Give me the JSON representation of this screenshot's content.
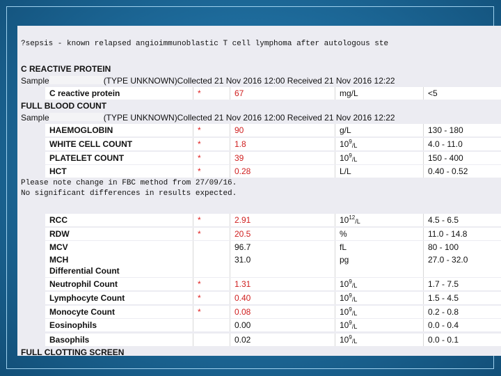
{
  "report": {
    "clinical_note": "?sepsis - known relapsed angioimmunoblastic T cell lymphoma after autologous ste",
    "crp": {
      "heading": "C REACTIVE PROTEIN",
      "sample_prefix": "Sample",
      "sample_suffix": "(TYPE UNKNOWN)Collected 21 Nov 2016 12:00 Received 21 Nov 2016 12:22",
      "rows": [
        {
          "name": "C reactive protein",
          "flag": "*",
          "value": "67",
          "unit": "mg/L",
          "ref": "<5"
        }
      ]
    },
    "fbc": {
      "heading": "FULL BLOOD COUNT",
      "sample_prefix": "Sample",
      "sample_suffix": "(TYPE UNKNOWN)Collected 21 Nov 2016 12:00 Received 21 Nov 2016 12:22",
      "rows_a": [
        {
          "name": "HAEMOGLOBIN",
          "flag": "*",
          "value": "90",
          "unit": "g/L",
          "ref": "130 - 180"
        },
        {
          "name": "WHITE CELL COUNT",
          "flag": "*",
          "value": "1.8",
          "unit_base": "10",
          "unit_exp": "9",
          "unit_tail": "/L",
          "ref": "4.0 - 11.0"
        },
        {
          "name": "PLATELET COUNT",
          "flag": "*",
          "value": "39",
          "unit_base": "10",
          "unit_exp": "9",
          "unit_tail": "/L",
          "ref": "150 - 400"
        },
        {
          "name": "HCT",
          "flag": "*",
          "value": "0.28",
          "unit": "L/L",
          "ref": "0.40 - 0.52"
        }
      ],
      "note_line1": "Please note change in FBC method from 27/09/16.",
      "note_line2": "No significant differences in results expected.",
      "rows_b": [
        {
          "name": "RCC",
          "flag": "*",
          "value": "2.91",
          "unit_base": "10",
          "unit_exp": "12",
          "unit_tail": "/L",
          "ref": "4.5 - 6.5"
        },
        {
          "name": "RDW",
          "flag": "*",
          "value": "20.5",
          "unit": "%",
          "ref": "11.0 - 14.8"
        },
        {
          "name": "MCV",
          "flag": "",
          "value": "96.7",
          "unit": "fL",
          "ref": "80 - 100"
        },
        {
          "name": "MCH",
          "flag": "",
          "value": "31.0",
          "unit": "pg",
          "ref": "27.0 - 32.0"
        },
        {
          "name": "Differential Count",
          "flag": "",
          "value": "",
          "unit": "",
          "ref": ""
        },
        {
          "name": "Neutrophil Count",
          "flag": "*",
          "value": "1.31",
          "unit_base": "10",
          "unit_exp": "9",
          "unit_tail": "/L",
          "ref": "1.7 - 7.5"
        },
        {
          "name": "Lymphocyte Count",
          "flag": "*",
          "value": "0.40",
          "unit_base": "10",
          "unit_exp": "9",
          "unit_tail": "/L",
          "ref": "1.5 - 4.5"
        },
        {
          "name": "Monocyte Count",
          "flag": "*",
          "value": "0.08",
          "unit_base": "10",
          "unit_exp": "9",
          "unit_tail": "/L",
          "ref": "0.2 - 0.8"
        },
        {
          "name": "Eosinophils",
          "flag": "",
          "value": "0.00",
          "unit_base": "10",
          "unit_exp": "9",
          "unit_tail": "/L",
          "ref": "0.0 - 0.4"
        },
        {
          "name": "Basophils",
          "flag": "",
          "value": "0.02",
          "unit_base": "10",
          "unit_exp": "9",
          "unit_tail": "/L",
          "ref": "0.0 - 0.1"
        }
      ]
    },
    "clotting": {
      "heading": "FULL CLOTTING SCREEN"
    }
  },
  "colors": {
    "abnormal": "#d02020",
    "background_blue": "#1f6e9f",
    "panel": "#ececf2"
  }
}
